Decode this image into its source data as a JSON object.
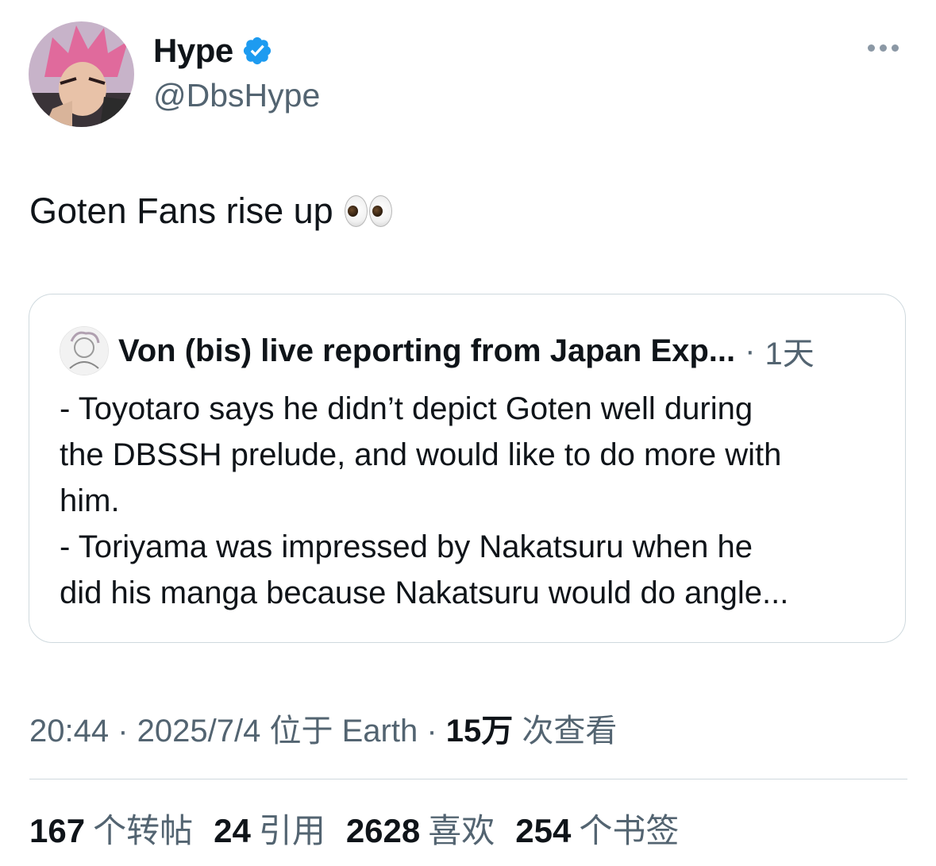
{
  "author": {
    "display_name": "Hype",
    "handle": "@DbsHype",
    "verified_color": "#1d9bf0"
  },
  "tweet": {
    "text": "Goten Fans rise up",
    "emoji": "eyes-emoji"
  },
  "quoted": {
    "name": "Von (bis) live reporting from Japan Exp...",
    "separator": "·",
    "time": "1天",
    "lines": [
      "- Toyotaro says he didn’t depict Goten well during",
      "the DBSSH prelude, and would like to do more with",
      "him.",
      "- Toriyama was impressed by Nakatsuru when he",
      "did his manga because Nakatsuru would do angle..."
    ]
  },
  "meta": {
    "time": "20:44",
    "sep1": " · ",
    "date": "2025/7/4",
    "location": " 位于 Earth",
    "sep2": " · ",
    "views_count": "15万",
    "views_label": " 次查看"
  },
  "stats": {
    "retweets": {
      "count": "167",
      "label": "个转帖"
    },
    "quotes": {
      "count": "24",
      "label": "引用"
    },
    "likes": {
      "count": "2628",
      "label": "喜欢"
    },
    "bookmarks": {
      "count": "254",
      "label": "个书签"
    }
  }
}
